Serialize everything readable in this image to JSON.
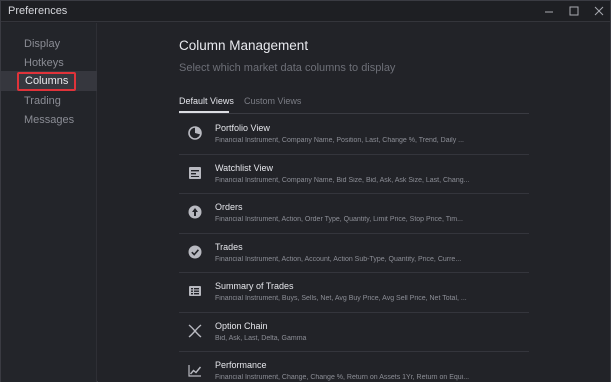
{
  "window": {
    "title": "Preferences"
  },
  "sidebar": {
    "items": [
      {
        "label": "Display"
      },
      {
        "label": "Hotkeys"
      },
      {
        "label": "Columns",
        "active": true
      },
      {
        "label": "Trading"
      },
      {
        "label": "Messages"
      }
    ]
  },
  "main": {
    "heading": "Column Management",
    "subheading": "Select which market data columns to display",
    "tabs": [
      {
        "label": "Default Views",
        "selected": true
      },
      {
        "label": "Custom Views",
        "selected": false
      }
    ],
    "views": [
      {
        "name": "Portfolio View",
        "columns": "Financial Instrument, Company Name, Position, Last, Change %, Trend, Daily ...",
        "icon": "portfolio-icon"
      },
      {
        "name": "Watchlist View",
        "columns": "Financial Instrument, Company Name, Bid Size, Bid, Ask, Ask Size, Last, Chang...",
        "icon": "watchlist-icon"
      },
      {
        "name": "Orders",
        "columns": "Financial Instrument, Action, Order Type, Quantity, Limit Price, Stop Price, Tim...",
        "icon": "orders-icon"
      },
      {
        "name": "Trades",
        "columns": "Financial Instrument, Action, Account, Action Sub-Type, Quantity, Price, Curre...",
        "icon": "trades-icon"
      },
      {
        "name": "Summary of Trades",
        "columns": "Financial Instrument, Buys, Sells, Net, Avg Buy Price, Avg Sell Price, Net Total, ...",
        "icon": "summary-icon"
      },
      {
        "name": "Option Chain",
        "columns": "Bid, Ask, Last, Delta, Gamma",
        "icon": "option-chain-icon"
      },
      {
        "name": "Performance",
        "columns": "Financial Instrument, Change, Change %, Return on Assets 1Yr, Return on Equi...",
        "icon": "performance-icon"
      }
    ]
  },
  "colors": {
    "active_outline": "#e0333a",
    "background": "#222328",
    "sidebar": "#23252a"
  }
}
